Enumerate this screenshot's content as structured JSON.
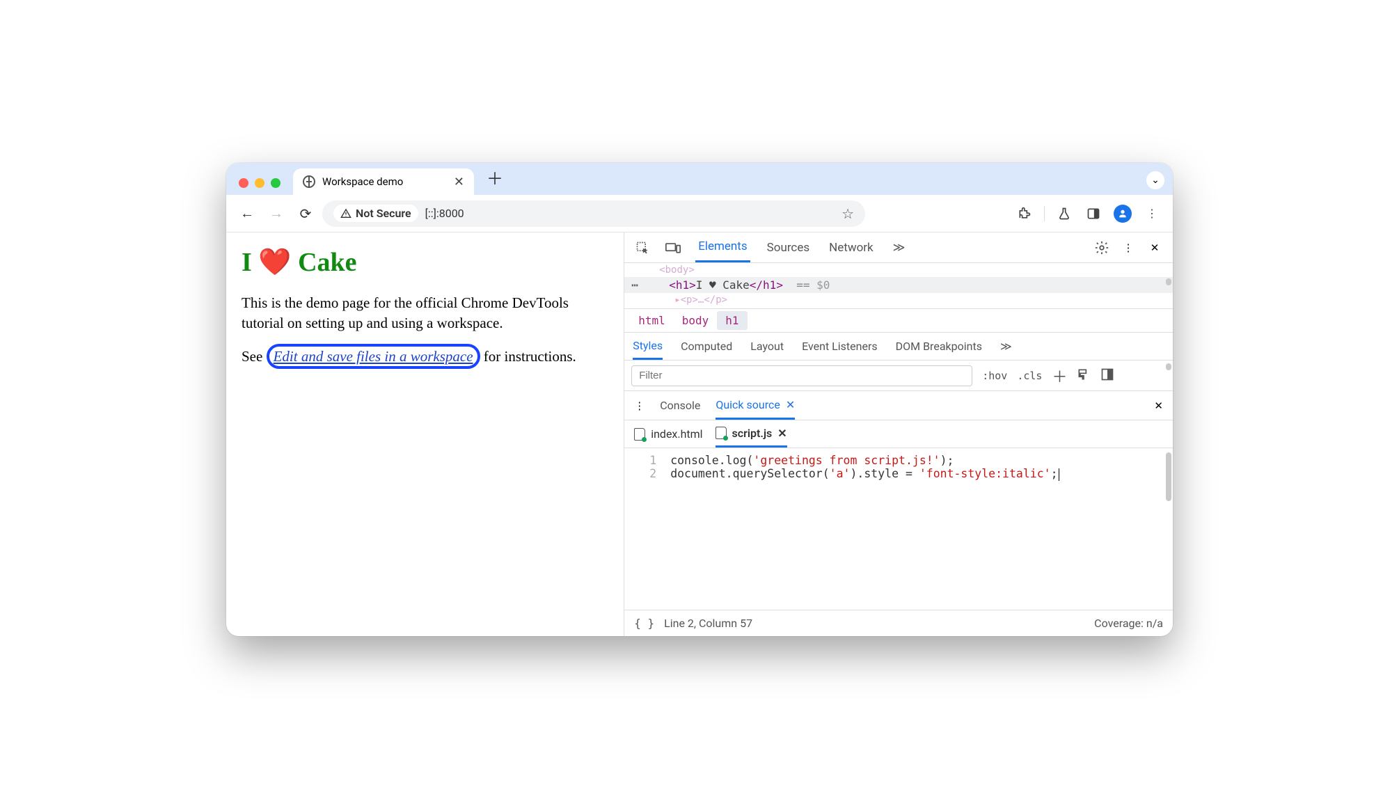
{
  "browser": {
    "tab_title": "Workspace demo",
    "security_label": "Not Secure",
    "address": "[::]:8000"
  },
  "page": {
    "heading": "I ❤️ Cake",
    "p1": "This is the demo page for the official Chrome DevTools tutorial on setting up and using a workspace.",
    "p2_before": "See ",
    "p2_link": "Edit and save files in a workspace",
    "p2_after": " for instructions."
  },
  "devtools": {
    "tabs": {
      "elements": "Elements",
      "sources": "Sources",
      "network": "Network"
    },
    "dom": {
      "above": "<body>",
      "open_tag": "<h1>",
      "text": "I ♥ Cake",
      "close_tag": "</h1>",
      "eq": "== ",
      "dollar": "$0",
      "below": "<p>…</p>"
    },
    "breadcrumb": {
      "html": "html",
      "body": "body",
      "h1": "h1"
    },
    "styles_tabs": {
      "styles": "Styles",
      "computed": "Computed",
      "layout": "Layout",
      "events": "Event Listeners",
      "dom_bp": "DOM Breakpoints"
    },
    "filter_placeholder": "Filter",
    "hov": ":hov",
    "cls": ".cls",
    "drawer": {
      "console": "Console",
      "quick": "Quick source"
    },
    "files": {
      "index": "index.html",
      "script": "script.js"
    },
    "code": {
      "lines": [
        "1",
        "2"
      ],
      "l1_a": "console.log(",
      "l1_s": "'greetings from script.js!'",
      "l1_b": ");",
      "l2_a": "document.querySelector(",
      "l2_s1": "'a'",
      "l2_b": ").style = ",
      "l2_s2": "'font-style:italic'",
      "l2_c": ";"
    },
    "status": {
      "pos": "Line 2, Column 57",
      "coverage": "Coverage: n/a"
    }
  }
}
